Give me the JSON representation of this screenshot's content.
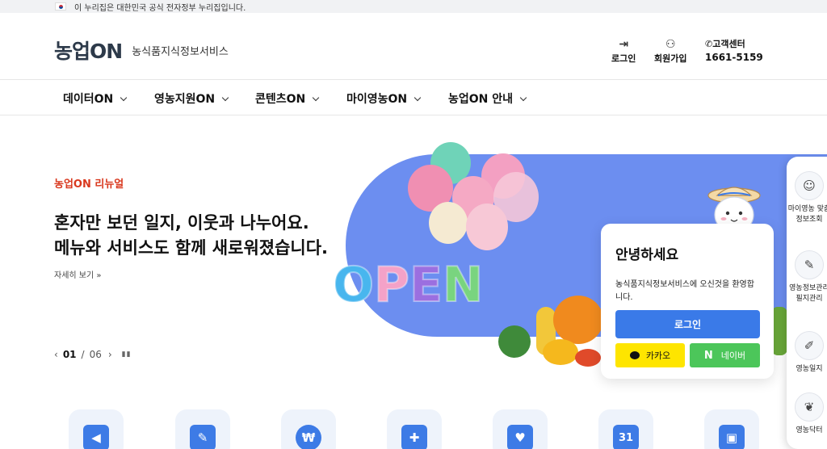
{
  "gov_banner": {
    "text": "이 누리집은 대한민국 공식 전자정부 누리집입니다."
  },
  "header": {
    "logo_text": "농업ON",
    "service_name": "농식품지식정보서비스",
    "login_label": "로그인",
    "join_label": "회원가입",
    "cs_label": "고객센터",
    "cs_phone": "1661-5159"
  },
  "nav": {
    "items": [
      {
        "label": "데이터ON"
      },
      {
        "label": "영농지원ON"
      },
      {
        "label": "콘텐츠ON"
      },
      {
        "label": "마이영농ON"
      },
      {
        "label": "농업ON 안내"
      }
    ]
  },
  "hero": {
    "eyebrow": "농업ON 리뉴얼",
    "title_line1": "혼자만 보던 일지, 이웃과 나누어요.",
    "title_line2": "메뉴와 서비스도 함께 새로워졌습니다.",
    "more_label": "자세히 보기 »",
    "current_slide": "01",
    "total_slides": "06",
    "open_letters": [
      "O",
      "P",
      "E",
      "N"
    ]
  },
  "login_card": {
    "greeting": "안녕하세요",
    "message": "농식품지식정보서비스에 오신것을 환영합니다.",
    "login_button": "로그인",
    "kakao_button": "카카오",
    "naver_button": "네이버"
  },
  "side_panel": {
    "items": [
      {
        "label": "마이영농 맞춤정보조회",
        "icon": "smile-icon"
      },
      {
        "label": "영농정보관리 필지관리",
        "icon": "edit-icon"
      },
      {
        "label": "영농일지",
        "icon": "pencil-icon"
      },
      {
        "label": "영농닥터",
        "icon": "sprout-icon"
      }
    ]
  },
  "quick_icons": [
    {
      "icon": "megaphone-icon",
      "color": "#3d7be6"
    },
    {
      "icon": "pen-icon",
      "color": "#3d7be6"
    },
    {
      "icon": "money-bag-icon",
      "color": "#3d7be6"
    },
    {
      "icon": "puzzle-icon",
      "color": "#3d7be6"
    },
    {
      "icon": "heart-hand-icon",
      "color": "#3d7be6"
    },
    {
      "icon": "calendar-icon",
      "color": "#3d7be6",
      "text": "31"
    },
    {
      "icon": "presentation-icon",
      "color": "#3d7be6"
    }
  ],
  "colors": {
    "accent_blue": "#3a7ae8",
    "hero_red": "#d9381e",
    "kakao_yellow": "#fee500",
    "naver_green": "#4cc65a",
    "hero_pill": "#6c8ef0"
  }
}
